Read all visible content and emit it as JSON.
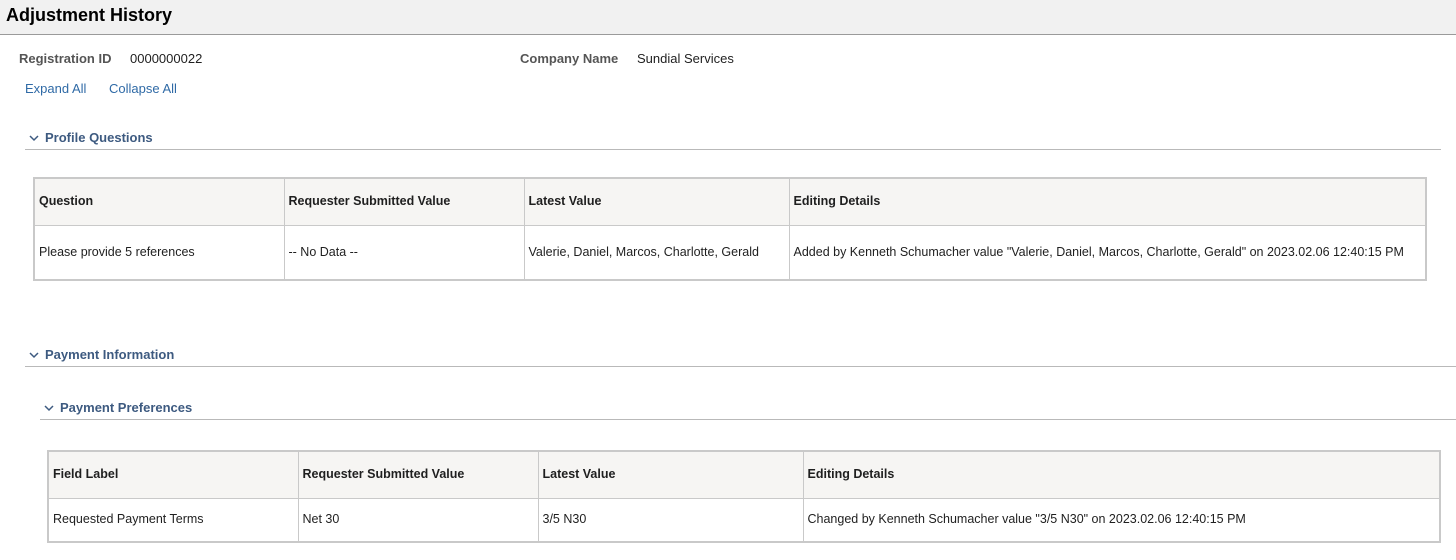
{
  "page": {
    "title": "Adjustment History"
  },
  "header": {
    "registration_label": "Registration ID",
    "registration_value": "0000000022",
    "company_label": "Company Name",
    "company_value": "Sundial Services"
  },
  "actions": {
    "expand_all": "Expand All",
    "collapse_all": "Collapse All"
  },
  "profile_section": {
    "title": "Profile Questions",
    "columns": [
      "Question",
      "Requester Submitted Value",
      "Latest Value",
      "Editing Details"
    ],
    "rows": [
      [
        "Please provide 5 references",
        "-- No Data --",
        "Valerie, Daniel, Marcos, Charlotte, Gerald",
        "Added by Kenneth Schumacher value \"Valerie, Daniel, Marcos, Charlotte, Gerald\" on 2023.02.06 12:40:15 PM"
      ]
    ]
  },
  "payment_section": {
    "title": "Payment Information",
    "subsection": {
      "title": "Payment Preferences",
      "columns": [
        "Field Label",
        "Requester Submitted Value",
        "Latest Value",
        "Editing Details"
      ],
      "rows": [
        [
          "Requested Payment Terms",
          "Net 30",
          "3/5 N30",
          "Changed by Kenneth Schumacher value \"3/5 N30\" on 2023.02.06 12:40:15 PM"
        ]
      ]
    }
  },
  "icons": {
    "collapse": "chevron-down-icon"
  }
}
